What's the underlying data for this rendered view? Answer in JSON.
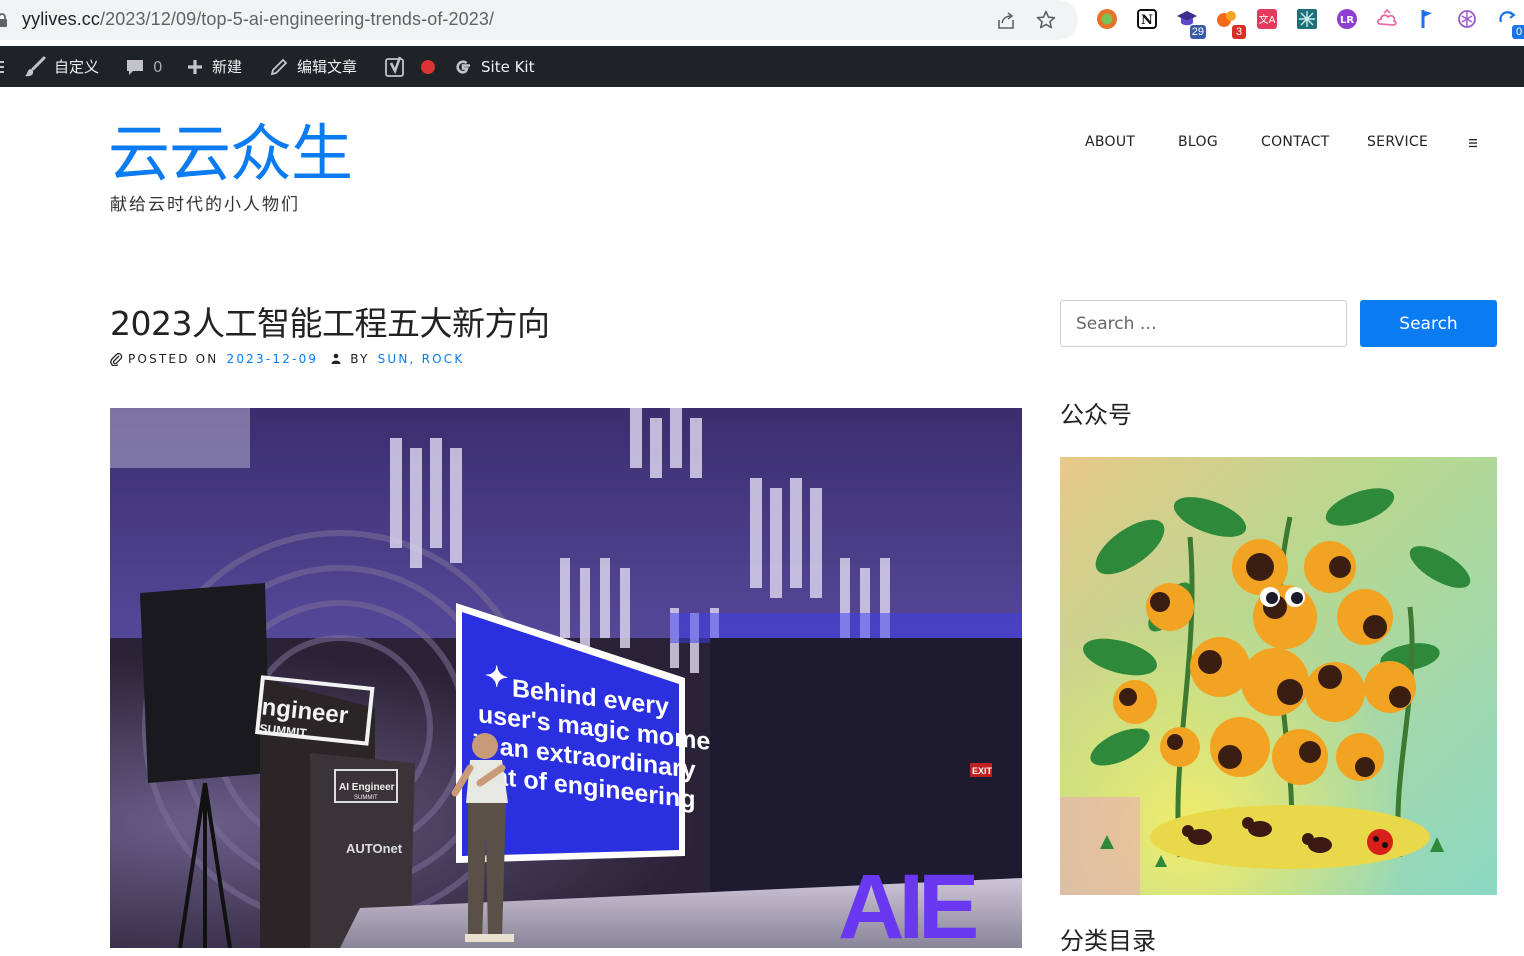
{
  "browser": {
    "url_host": "yylives.cc",
    "url_path": "/2023/12/09/top-5-ai-engineering-trends-of-2023/",
    "extensions": [
      {
        "name": "chrome-extension-icon",
        "badge": ""
      },
      {
        "name": "notion-icon",
        "badge": ""
      },
      {
        "name": "graduation-cap-icon",
        "badge": "29"
      },
      {
        "name": "bubbles-extension-icon",
        "badge": "3"
      },
      {
        "name": "translate-icon",
        "badge": ""
      },
      {
        "name": "grid-extension-icon",
        "badge": ""
      },
      {
        "name": "circle-letter-icon",
        "badge": ""
      },
      {
        "name": "cloud-extension-icon",
        "badge": ""
      },
      {
        "name": "flag-extension-icon",
        "badge": ""
      },
      {
        "name": "openai-icon",
        "badge": ""
      },
      {
        "name": "sync-extension-icon",
        "badge": "0"
      }
    ],
    "colors": {
      "badge_blue": "#1a73e8",
      "badge_red": "#d93025"
    }
  },
  "admin_bar": {
    "customize_label": "自定义",
    "comments_count": "0",
    "new_label": "新建",
    "edit_label": "编辑文章",
    "sitekit_label": "Site Kit",
    "colors": {
      "background": "#1d2327",
      "status_dot": "#dc3232"
    }
  },
  "site": {
    "title": "云云众生",
    "description": "献给云时代的小人物们",
    "nav": [
      "ABOUT",
      "BLOG",
      "CONTACT",
      "SERVICE"
    ],
    "accent_color": "#0b7bf2"
  },
  "post": {
    "title": "2023人工智能工程五大新方向",
    "posted_on_label": "POSTED ON",
    "date": "2023-12-09",
    "by_label": "BY",
    "author": "SUN, ROCK",
    "image": {
      "screen_lines": [
        "Behind every",
        "user's magic moment",
        "is an extraordinary",
        "feat of engineering"
      ],
      "booth_text": [
        "ngineer",
        "SUMMIT"
      ],
      "podium_text": [
        "AI Engineer",
        "SUMMIT"
      ],
      "sponsor_text": "AUTOnet",
      "exit_sign": "EXIT",
      "stage_letters": "AIE"
    }
  },
  "sidebar": {
    "search_placeholder": "Search …",
    "search_button": "Search",
    "widget_wechat_title": "公众号",
    "widget_categories_title": "分类目录"
  }
}
